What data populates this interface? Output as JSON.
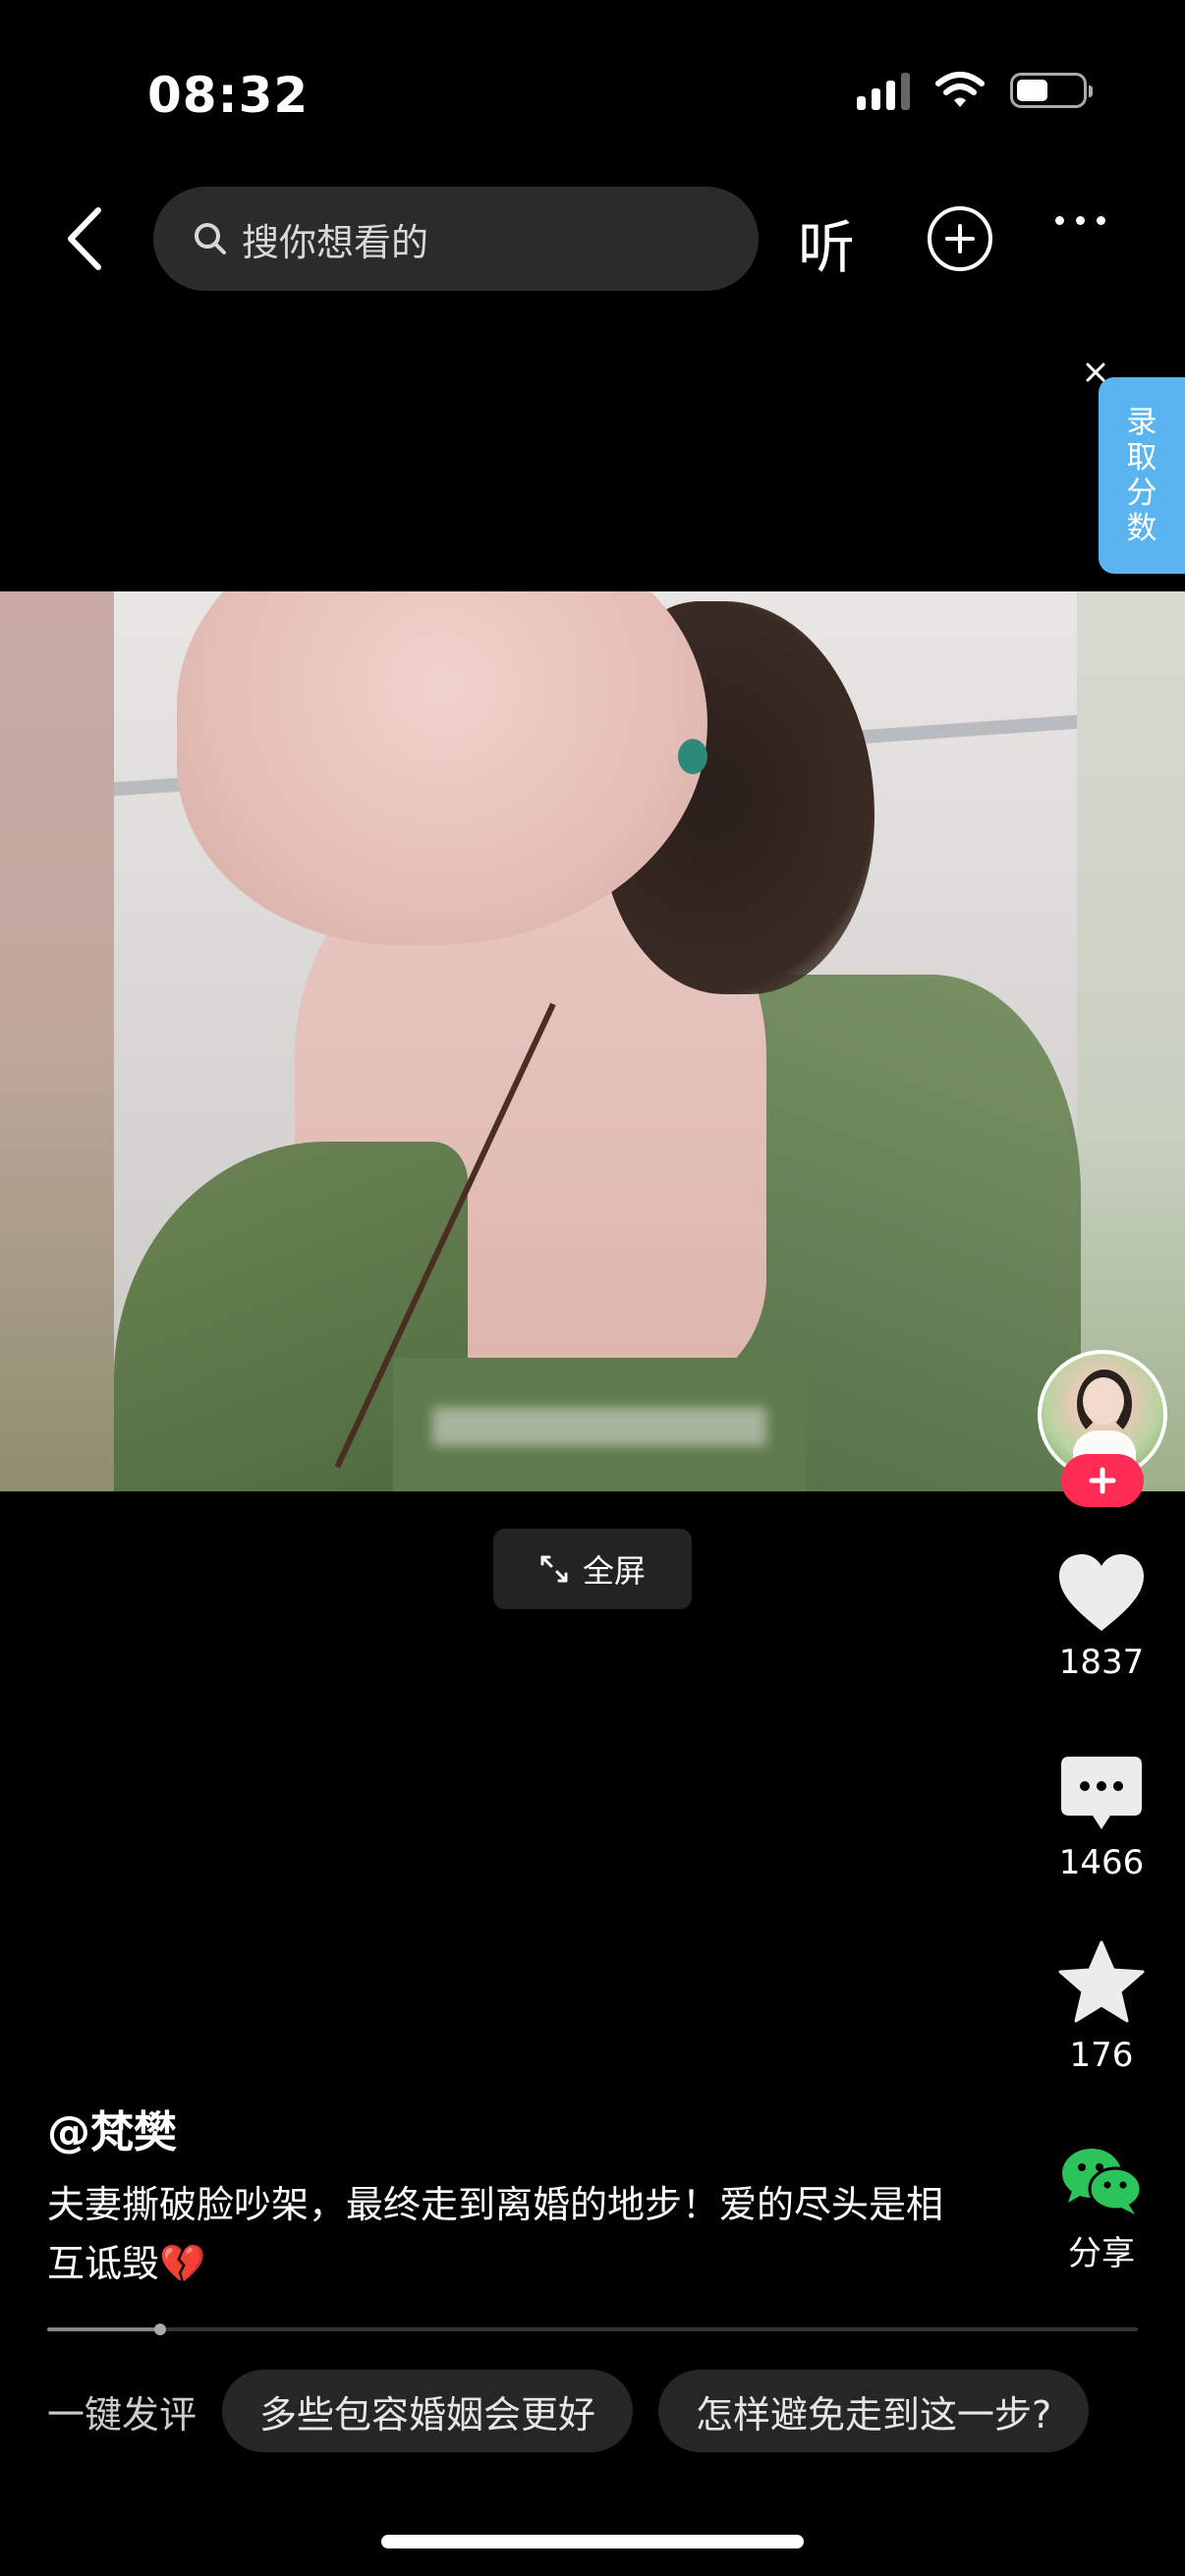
{
  "status_bar": {
    "time": "08:32"
  },
  "header": {
    "search_placeholder": "搜你想看的",
    "listen_label": "听"
  },
  "side_tag": {
    "lines": [
      "录",
      "取",
      "分",
      "数"
    ]
  },
  "video": {
    "fullscreen_label": "全屏"
  },
  "actions": {
    "likes": "1837",
    "comments": "1466",
    "favorites": "176",
    "share_label": "分享"
  },
  "post": {
    "author": "@梵樊",
    "description": "夫妻撕破脸吵架，最终走到离婚的地步！爱的尽头是相互诋毁💔",
    "progress": 0.104
  },
  "comment_bar": {
    "label": "一键发评",
    "chips": [
      "多些包容婚姻会更好",
      "怎样避免走到这一步?"
    ]
  },
  "colors": {
    "accent_red": "#fe2c55",
    "tag_blue": "#5ab4f0",
    "wechat_green": "#2bc45b"
  }
}
